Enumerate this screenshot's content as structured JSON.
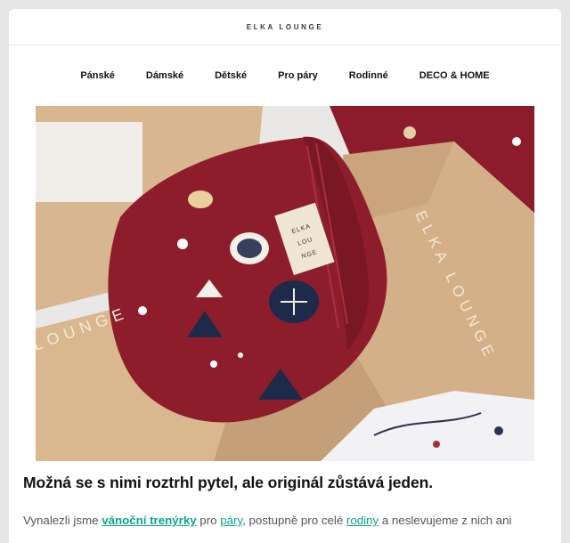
{
  "brand": {
    "name": "ELKA LOUNGE"
  },
  "nav": {
    "items": [
      {
        "label": "Pánské"
      },
      {
        "label": "Dámské"
      },
      {
        "label": "Dětské"
      },
      {
        "label": "Pro páry"
      },
      {
        "label": "Rodinné"
      },
      {
        "label": "DECO & HOME"
      }
    ]
  },
  "hero": {
    "box_print": "ELKA LOUNGE",
    "tag_print": "ELKA LOU NGE",
    "box_front_print": "LOUNGE"
  },
  "article": {
    "headline": "Možná se s nimi roztrhl pytel, ale originál zůstává jeden.",
    "p1_start": "Vynalezli jsme ",
    "link1": "vánoční trenýrky",
    "p1_mid1": " pro ",
    "link2": "páry",
    "p1_mid2": ", postupně pro celé ",
    "link3": "rodiny",
    "p1_end": " a neslevujeme z nich ani"
  },
  "colors": {
    "accent_link": "#0aa58a",
    "fabric": "#8c1c2b",
    "cardboard": "#d7b48c"
  }
}
